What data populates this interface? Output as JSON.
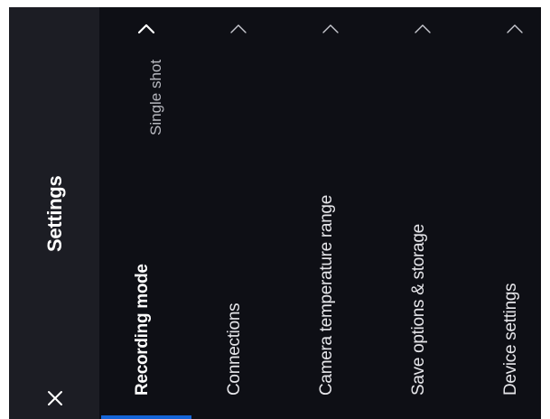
{
  "header": {
    "title": "Settings",
    "close_icon": "close-icon"
  },
  "settings_items": [
    {
      "label": "Recording mode",
      "value": "Single shot",
      "icon": "chevron-up-icon",
      "active": true
    },
    {
      "label": "Connections",
      "value": "",
      "icon": "chevron-up-icon",
      "active": false
    },
    {
      "label": "Camera temperature range",
      "value": "",
      "icon": "chevron-up-icon",
      "active": false
    },
    {
      "label": "Save options & storage",
      "value": "",
      "icon": "chevron-up-icon",
      "active": false
    },
    {
      "label": "Device settings",
      "value": "",
      "icon": "chevron-up-icon",
      "active": false
    }
  ],
  "colors": {
    "background": "#0e0f15",
    "sidebar": "#1c1d24",
    "accent": "#1565d8",
    "text": "#ffffff",
    "secondary_text": "#b7b8bf"
  }
}
